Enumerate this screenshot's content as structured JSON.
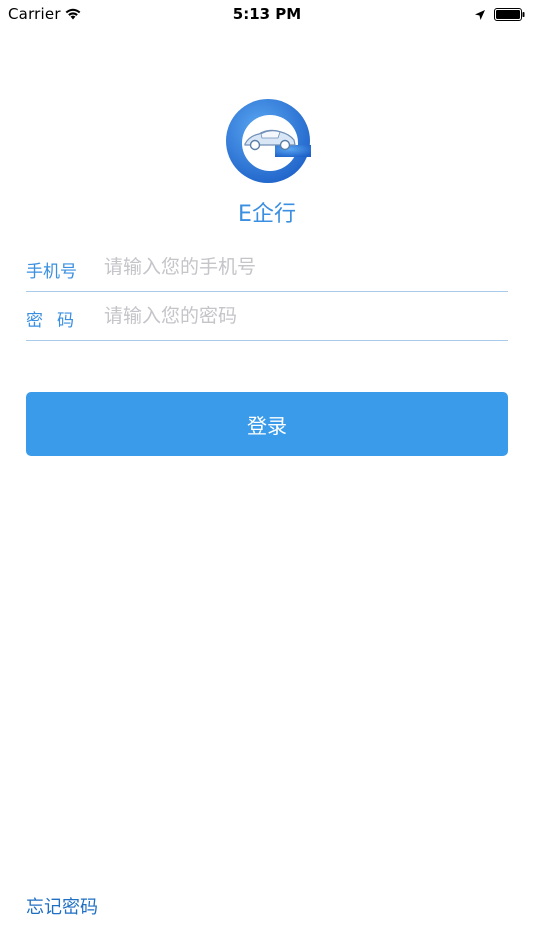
{
  "status_bar": {
    "carrier": "Carrier",
    "time": "5:13 PM"
  },
  "app": {
    "name": "E企行"
  },
  "form": {
    "phone": {
      "label": "手机号",
      "placeholder": "请输入您的手机号",
      "value": ""
    },
    "password": {
      "label": "密码",
      "placeholder": "请输入您的密码",
      "value": ""
    }
  },
  "actions": {
    "login_label": "登录",
    "forgot_password_label": "忘记密码"
  },
  "colors": {
    "accent": "#3a9bea",
    "label_blue": "#3a8fe0",
    "link_blue": "#1f6fc4",
    "divider": "#a9cbe9"
  }
}
